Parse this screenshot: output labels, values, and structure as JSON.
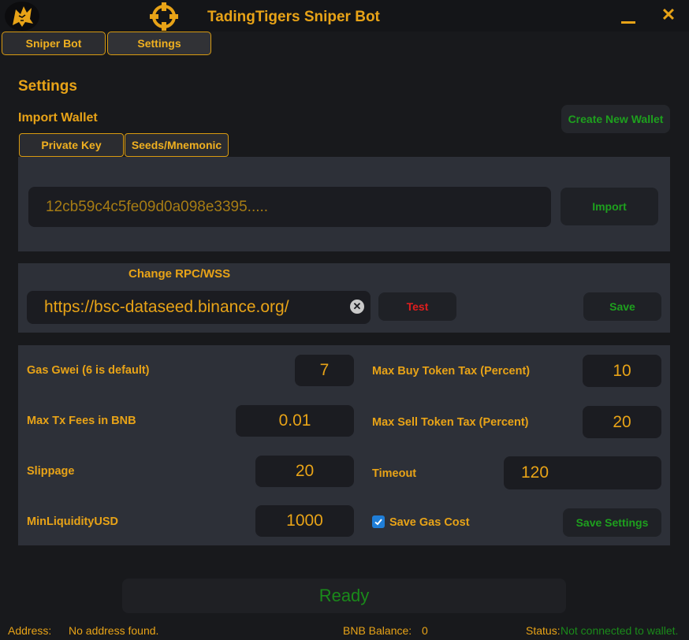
{
  "titlebar": {
    "title": "TadingTigers Sniper Bot",
    "minimize_icon": "minimize-icon",
    "close_label": "✕"
  },
  "tabs": [
    {
      "label": "Sniper Bot"
    },
    {
      "label": "Settings"
    }
  ],
  "settings": {
    "heading": "Settings",
    "import_wallet": {
      "heading": "Import Wallet",
      "create_button": "Create New Wallet",
      "subtabs": [
        {
          "label": "Private Key"
        },
        {
          "label": "Seeds/Mnemonic"
        }
      ],
      "key_value": "12cb59c4c5fe09d0a098e3395.....",
      "import_button": "Import"
    },
    "rpc": {
      "heading": "Change RPC/WSS",
      "value": "https://bsc-dataseed.binance.org/",
      "test_button": "Test",
      "save_button": "Save"
    },
    "params": {
      "gas_gwei_label": "Gas Gwei (6 is default)",
      "gas_gwei_value": "7",
      "max_tx_fees_label": "Max Tx Fees in BNB",
      "max_tx_fees_value": "0.01",
      "slippage_label": "Slippage",
      "slippage_value": "20",
      "min_liquidity_label": "MinLiquidityUSD",
      "min_liquidity_value": "1000",
      "max_buy_tax_label": "Max Buy Token Tax (Percent)",
      "max_buy_tax_value": "10",
      "max_sell_tax_label": "Max Sell Token Tax (Percent)",
      "max_sell_tax_value": "20",
      "timeout_label": "Timeout",
      "timeout_value": "120",
      "save_gas_label": "Save Gas Cost",
      "save_gas_checked": true,
      "save_settings_button": "Save Settings"
    }
  },
  "ready_text": "Ready",
  "statusbar": {
    "address_label": "Address:",
    "address_value": "No address found.",
    "bnb_label": "BNB Balance:",
    "bnb_value": "0",
    "status_label": "Status:",
    "status_value": "Not connected to wallet."
  },
  "colors": {
    "accent": "#e8a317",
    "success": "#1ea01e",
    "danger": "#e01e1e",
    "background": "#18191c",
    "panel": "#2d3038"
  }
}
